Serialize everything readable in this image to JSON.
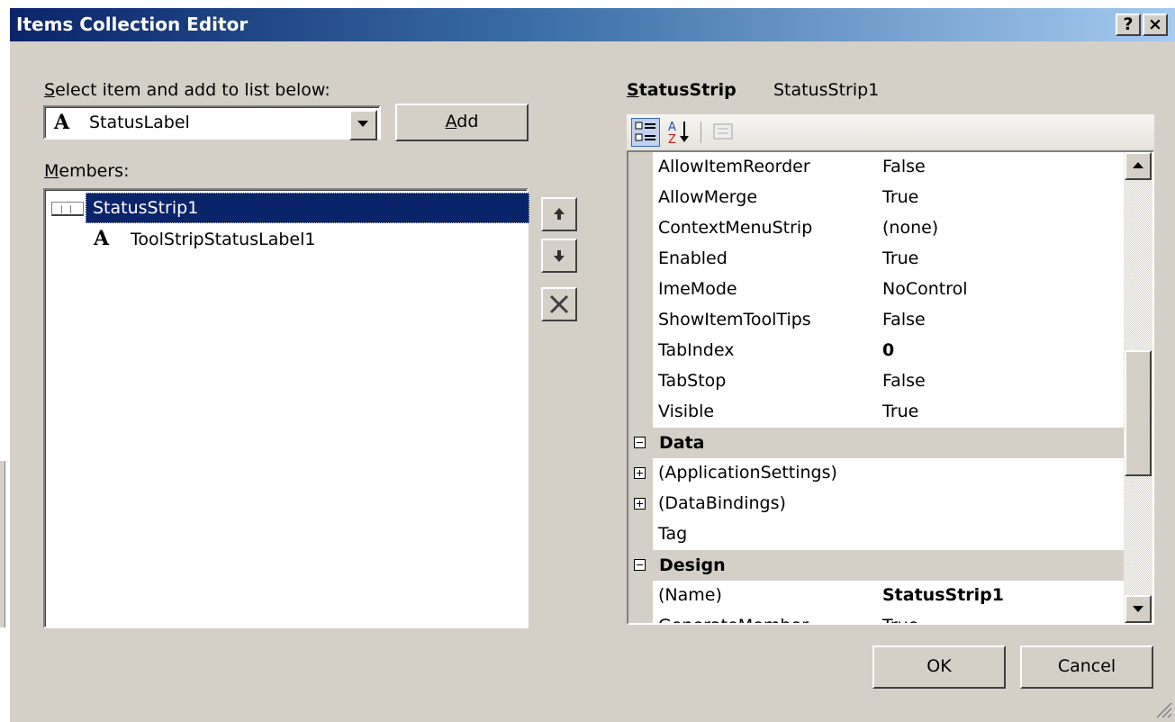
{
  "window": {
    "title": "Items Collection Editor",
    "help_glyph": "?",
    "close_glyph": "×"
  },
  "left": {
    "select_label_first": "S",
    "select_label_rest": "elect item and add to list below:",
    "combo_icon_glyph": "A",
    "combo_value": "StatusLabel",
    "add_button_first": "A",
    "add_button_rest": "dd",
    "members_label_first": "M",
    "members_label_rest": "embers:",
    "members": [
      {
        "label": "StatusStrip1",
        "icon": "status-strip-icon",
        "selected": true
      },
      {
        "label": "ToolStripStatusLabel1",
        "icon": "text-label-icon",
        "icon_glyph": "A",
        "selected": false
      }
    ]
  },
  "right": {
    "header_type_first": "S",
    "header_type_rest": "tatusStrip",
    "header_name": "StatusStrip1",
    "toolbar_icons": [
      "categorized-icon",
      "alphabetical-icon",
      "property-pages-icon"
    ],
    "rows": [
      {
        "type": "prop",
        "name": "AllowItemReorder",
        "value": "False"
      },
      {
        "type": "prop",
        "name": "AllowMerge",
        "value": "True"
      },
      {
        "type": "prop",
        "name": "ContextMenuStrip",
        "value": "(none)"
      },
      {
        "type": "prop",
        "name": "Enabled",
        "value": "True"
      },
      {
        "type": "prop",
        "name": "ImeMode",
        "value": "NoControl"
      },
      {
        "type": "prop",
        "name": "ShowItemToolTips",
        "value": "False"
      },
      {
        "type": "prop",
        "name": "TabIndex",
        "value": "0",
        "bold": true
      },
      {
        "type": "prop",
        "name": "TabStop",
        "value": "False"
      },
      {
        "type": "prop",
        "name": "Visible",
        "value": "True"
      },
      {
        "type": "cat",
        "name": "Data"
      },
      {
        "type": "prop",
        "name": "(ApplicationSettings)",
        "value": "",
        "expander": "plus"
      },
      {
        "type": "prop",
        "name": "(DataBindings)",
        "value": "",
        "expander": "plus"
      },
      {
        "type": "prop",
        "name": "Tag",
        "value": ""
      },
      {
        "type": "cat",
        "name": "Design"
      },
      {
        "type": "prop",
        "name": "(Name)",
        "value": "StatusStrip1",
        "bold": true
      },
      {
        "type": "prop",
        "name": "GenerateMember",
        "value": "True"
      }
    ]
  },
  "buttons": {
    "ok": "OK",
    "cancel": "Cancel"
  },
  "colors": {
    "title_gradient_start": "#0a246a",
    "title_gradient_end": "#a6caf0",
    "dialog_face": "#d4d0c8",
    "selection": "#0a246a"
  }
}
